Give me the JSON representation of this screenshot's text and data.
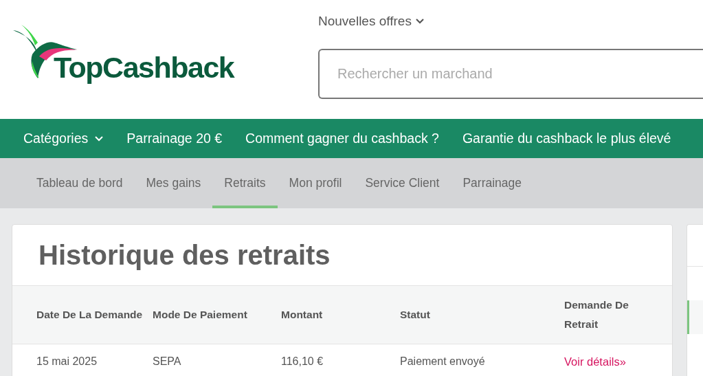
{
  "logo": {
    "text": "TopCashback"
  },
  "header": {
    "new_offers": {
      "label": "Nouvelles offres",
      "expanded": false
    },
    "search": {
      "placeholder": "Rechercher un marchand"
    }
  },
  "main_nav": [
    {
      "label": "Catégories",
      "dropdown": true
    },
    {
      "label": "Parrainage 20 €",
      "dropdown": false
    },
    {
      "label": "Comment gagner du cashback ?",
      "dropdown": false
    },
    {
      "label": "Garantie du cashback le plus élevé",
      "dropdown": false
    }
  ],
  "account_tabs": [
    {
      "label": "Tableau de bord",
      "selected": false
    },
    {
      "label": "Mes gains",
      "selected": false
    },
    {
      "label": "Retraits",
      "selected": true
    },
    {
      "label": "Mon profil",
      "selected": false
    },
    {
      "label": "Service Client",
      "selected": false
    },
    {
      "label": "Parrainage",
      "selected": false
    }
  ],
  "panel": {
    "title": "Historique des retraits",
    "table": {
      "columns": [
        "Date De La Demande",
        "Mode De Paiement",
        "Montant",
        "Statut",
        "Demande De Retrait"
      ],
      "rows": [
        {
          "cells": [
            "15 mai 2025",
            "SEPA",
            "116,10 €",
            "Paiement envoyé"
          ],
          "link": "Voir détails»"
        }
      ]
    }
  }
}
